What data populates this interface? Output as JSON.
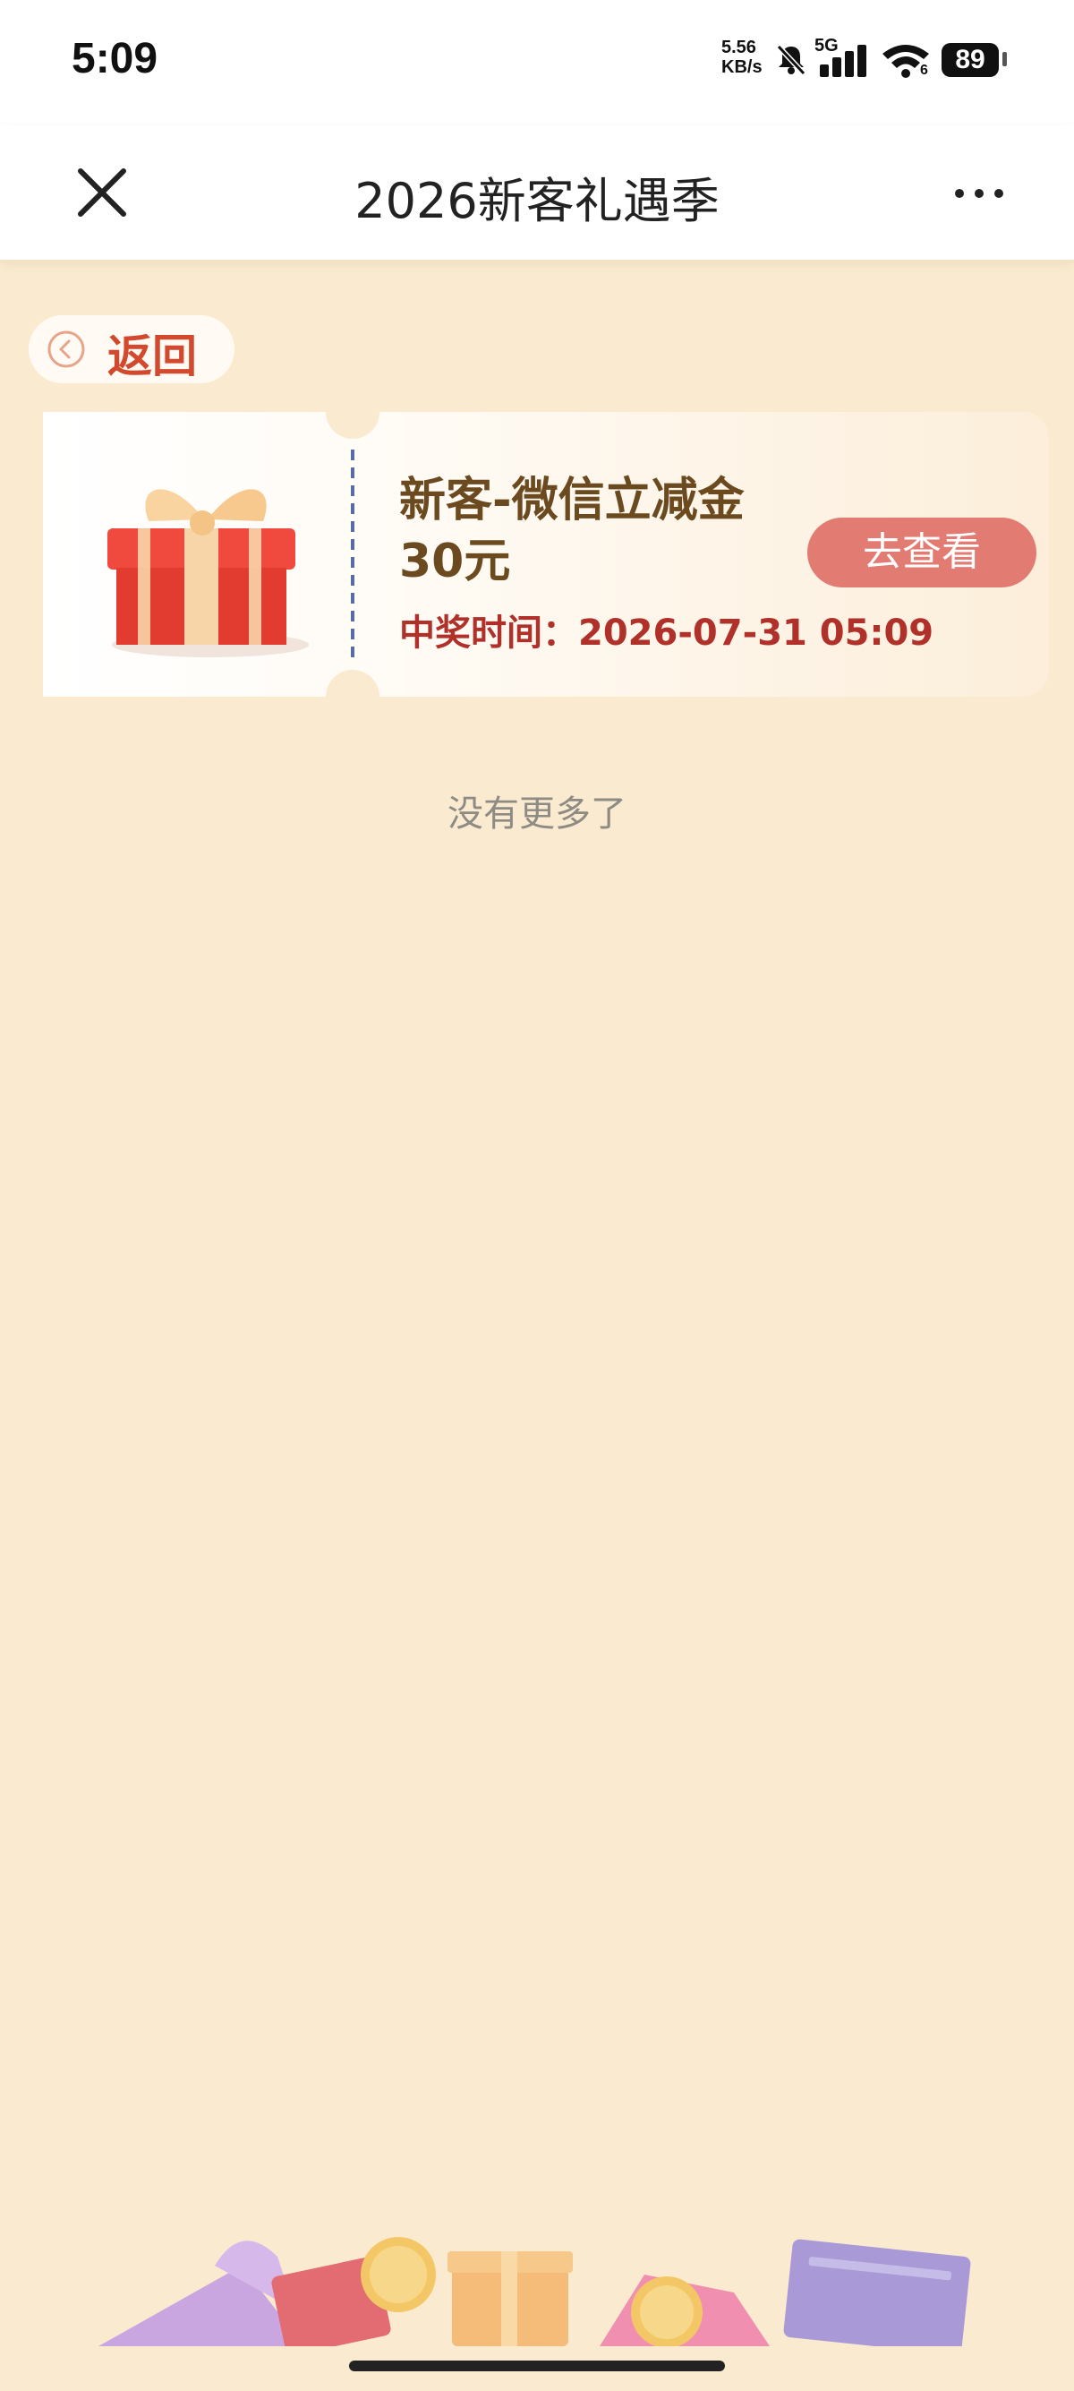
{
  "status_bar": {
    "time": "5:09",
    "net_speed_value": "5.56",
    "net_speed_unit": "KB/s",
    "network": "5G",
    "wifi_sub": "6",
    "battery": "89",
    "icons": [
      "mute-bell-icon",
      "signal-icon",
      "wifi-icon",
      "battery-icon"
    ]
  },
  "nav": {
    "title": "2026新客礼遇季",
    "close_icon": "close-icon",
    "more_icon": "more-icon"
  },
  "back": {
    "label": "返回",
    "icon": "chevron-left-circle-icon"
  },
  "prize": {
    "name": "新客-微信立减金",
    "amount": "30元",
    "win_time": "中奖时间：2026-07-31 05:09",
    "action_label": "去查看",
    "icon": "gift-box-icon"
  },
  "list_footer": "没有更多了",
  "colors": {
    "page_bg": "#FAEBD0",
    "accent_red": "#D2492E",
    "button": "#E27B72",
    "prize_text": "#6B4A1F",
    "time_text": "#B0302A"
  }
}
